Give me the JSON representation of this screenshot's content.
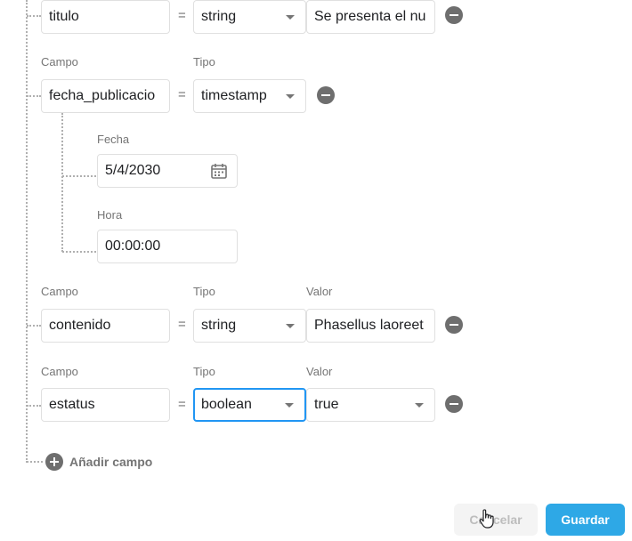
{
  "fields": [
    {
      "campo_label": "",
      "tipo_label": "",
      "valor_label": "",
      "campo": "titulo",
      "equals": "=",
      "tipo": "string",
      "valor": "Se presenta el nu"
    },
    {
      "campo_label": "Campo",
      "tipo_label": "Tipo",
      "campo": "fecha_publicacio",
      "equals": "=",
      "tipo": "timestamp",
      "fecha_label": "Fecha",
      "fecha": "5/4/2030",
      "hora_label": "Hora",
      "hora": "00:00:00"
    },
    {
      "campo_label": "Campo",
      "tipo_label": "Tipo",
      "valor_label": "Valor",
      "campo": "contenido",
      "equals": "=",
      "tipo": "string",
      "valor": "Phasellus laoreet"
    },
    {
      "campo_label": "Campo",
      "tipo_label": "Tipo",
      "valor_label": "Valor",
      "campo": "estatus",
      "equals": "=",
      "tipo": "boolean",
      "valor": "true"
    }
  ],
  "add_field_label": "Añadir campo",
  "buttons": {
    "cancel": "Cancelar",
    "save": "Guardar"
  },
  "colors": {
    "primary": "#2ea8e6",
    "focus_border": "#2196f3",
    "icon_gray": "#6e6e6e"
  }
}
